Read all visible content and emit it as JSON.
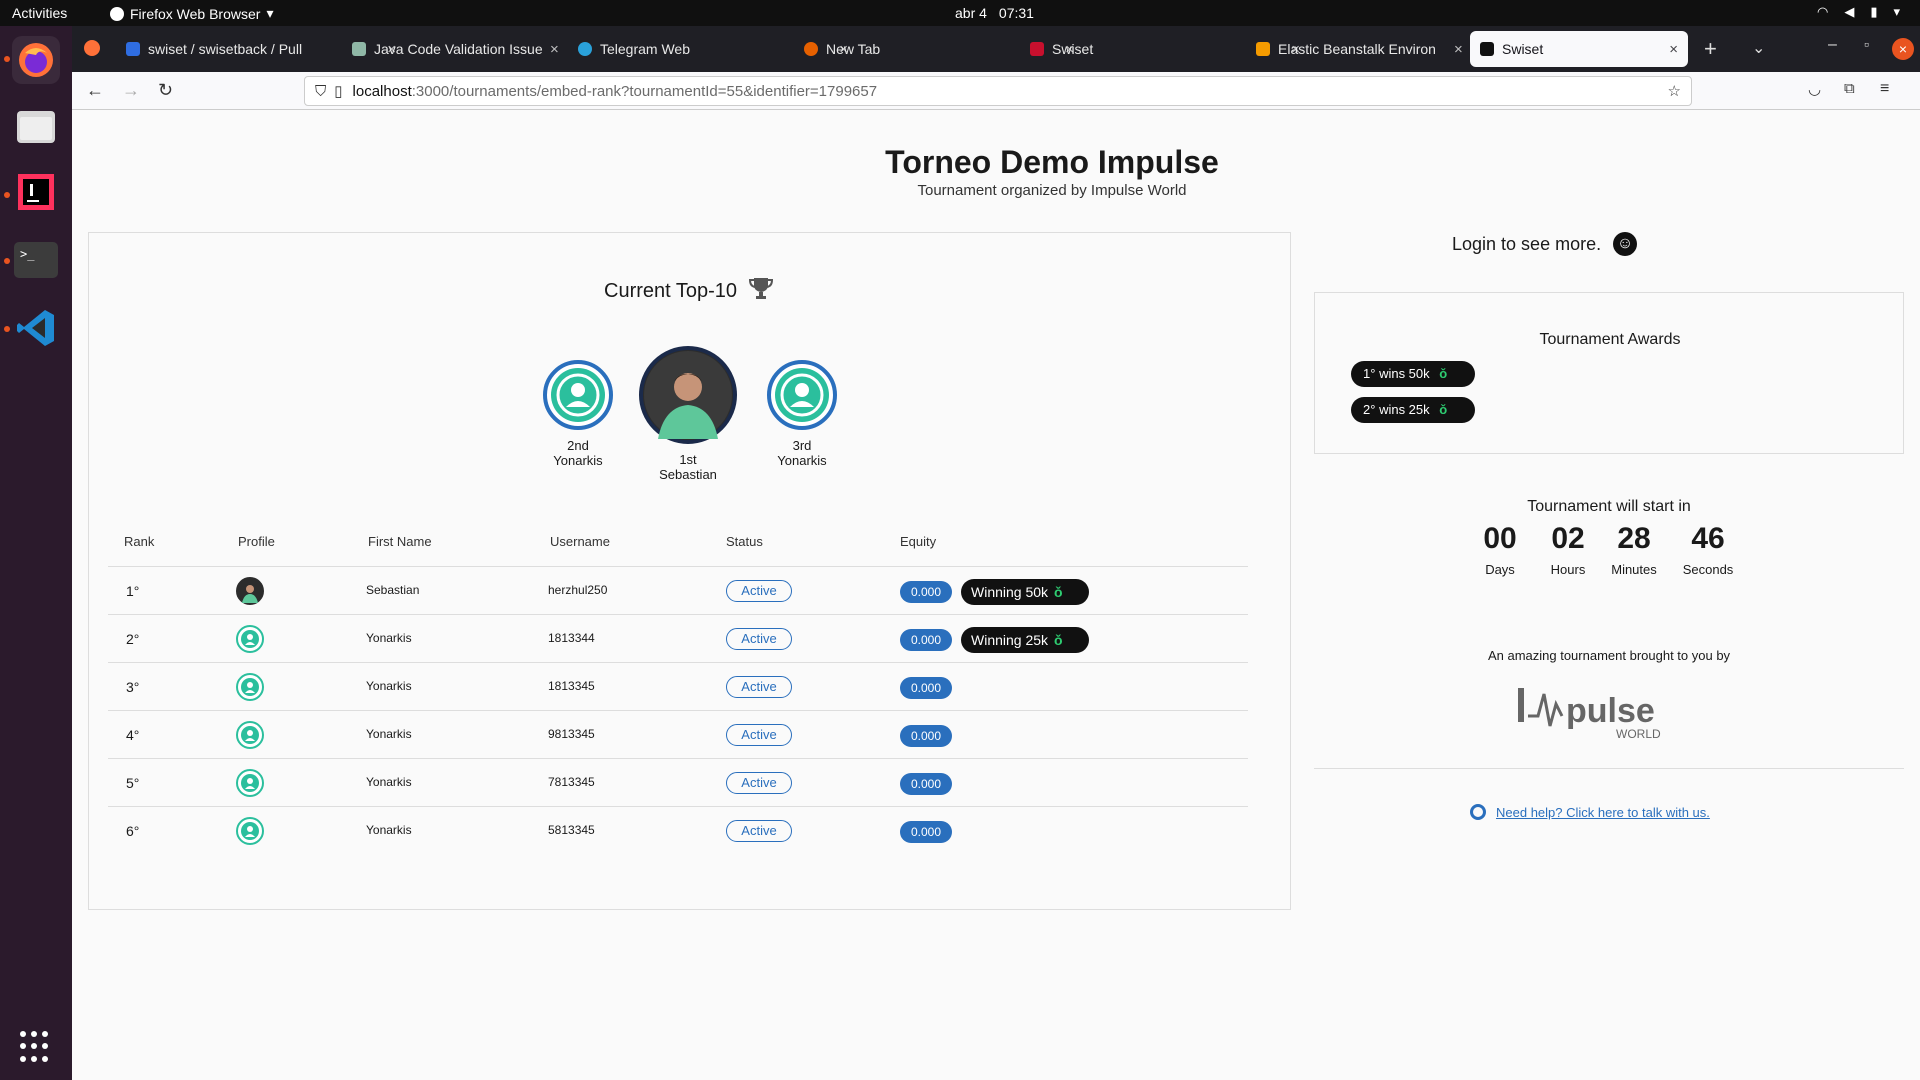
{
  "system": {
    "activities": "Activities",
    "app_name": "Firefox Web Browser",
    "date": "abr 4",
    "time": "07:31"
  },
  "tabs": [
    {
      "title": "swiset / swisetback / Pull",
      "fav": "#2f6de1",
      "close": "×"
    },
    {
      "title": "Java Code Validation Issue",
      "fav": "#8fb7a6",
      "close": "×"
    },
    {
      "title": "Telegram Web",
      "fav": "#2aa1da",
      "close": "×"
    },
    {
      "title": "New Tab",
      "fav": "#e66000",
      "close": "×"
    },
    {
      "title": "Swiset",
      "fav": "#c8102e",
      "close": "×"
    },
    {
      "title": "Elastic Beanstalk Environ",
      "fav": "#f59b00",
      "close": "×"
    },
    {
      "title": "Swiset",
      "fav": "#111111",
      "close": "×"
    }
  ],
  "url": {
    "host": "localhost",
    "path": ":3000/tournaments/embed-rank?tournamentId=55&identifier=1799657"
  },
  "header": {
    "title": "Torneo Demo Impulse",
    "subtitle": "Tournament organized by Impulse World"
  },
  "top10": {
    "label": "Current Top-10",
    "podium": [
      {
        "place": "2nd",
        "name": "Yonarkis"
      },
      {
        "place": "1st",
        "name": "Sebastian"
      },
      {
        "place": "3rd",
        "name": "Yonarkis"
      }
    ]
  },
  "table": {
    "headers": [
      "Rank",
      "Profile",
      "First Name",
      "Username",
      "Status",
      "Equity"
    ],
    "rows": [
      {
        "rank": "1°",
        "first": "Sebastian",
        "user": "herzhul250",
        "status": "Active",
        "equity": "0.000",
        "win": "Winning 50k"
      },
      {
        "rank": "2°",
        "first": "Yonarkis",
        "user": "1813344",
        "status": "Active",
        "equity": "0.000",
        "win": "Winning 25k"
      },
      {
        "rank": "3°",
        "first": "Yonarkis",
        "user": "1813345",
        "status": "Active",
        "equity": "0.000",
        "win": ""
      },
      {
        "rank": "4°",
        "first": "Yonarkis",
        "user": "9813345",
        "status": "Active",
        "equity": "0.000",
        "win": ""
      },
      {
        "rank": "5°",
        "first": "Yonarkis",
        "user": "7813345",
        "status": "Active",
        "equity": "0.000",
        "win": ""
      },
      {
        "rank": "6°",
        "first": "Yonarkis",
        "user": "5813345",
        "status": "Active",
        "equity": "0.000",
        "win": ""
      }
    ]
  },
  "sidebar": {
    "login": "Login to see more.",
    "awards_title": "Tournament Awards",
    "awards": [
      {
        "place": "1°",
        "text": "wins 50k"
      },
      {
        "place": "2°",
        "text": "wins 25k"
      }
    ],
    "countdown_title": "Tournament will start in",
    "countdown": [
      {
        "value": "00",
        "label": "Days"
      },
      {
        "value": "02",
        "label": "Hours"
      },
      {
        "value": "28",
        "label": "Minutes"
      },
      {
        "value": "46",
        "label": "Seconds"
      }
    ],
    "brought": "An amazing tournament brought to you by",
    "logo_text": "pulse",
    "logo_sub": "WORLD",
    "help": "Need help? Click here to talk with us."
  },
  "colors": {
    "accent": "#2a6fbd",
    "teal": "#2bbf9d",
    "dark": "#111111"
  }
}
